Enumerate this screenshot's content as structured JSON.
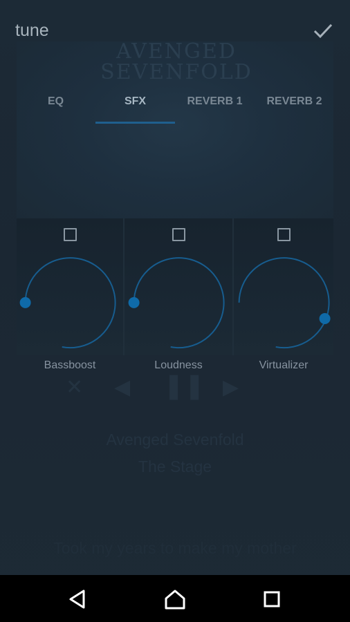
{
  "app": {
    "title": "tune"
  },
  "background": {
    "band_line1": "AVENGED",
    "band_line2": "SEVENFOLD",
    "artist": "Avenged Sevenfold",
    "track": "The Stage",
    "lyrics": "Took my years to make my mother"
  },
  "tabs": [
    {
      "label": "EQ",
      "active": false
    },
    {
      "label": "SFX",
      "active": true
    },
    {
      "label": "REVERB 1",
      "active": false
    },
    {
      "label": "REVERB 2",
      "active": false
    }
  ],
  "effects": [
    {
      "label": "Bassboost",
      "enabled": false,
      "level": 0.0
    },
    {
      "label": "Loudness",
      "enabled": false,
      "level": 0.0
    },
    {
      "label": "Virtualizer",
      "enabled": false,
      "level": 1.0
    }
  ],
  "colors": {
    "accent": "#0f6aa8",
    "arc": "#175d8f",
    "tab_indicator": "#1f5f8e",
    "navbar": "#000000"
  },
  "icons": {
    "done": "check-icon",
    "back": "back-triangle-icon",
    "home": "home-icon",
    "recents": "recents-square-icon"
  }
}
